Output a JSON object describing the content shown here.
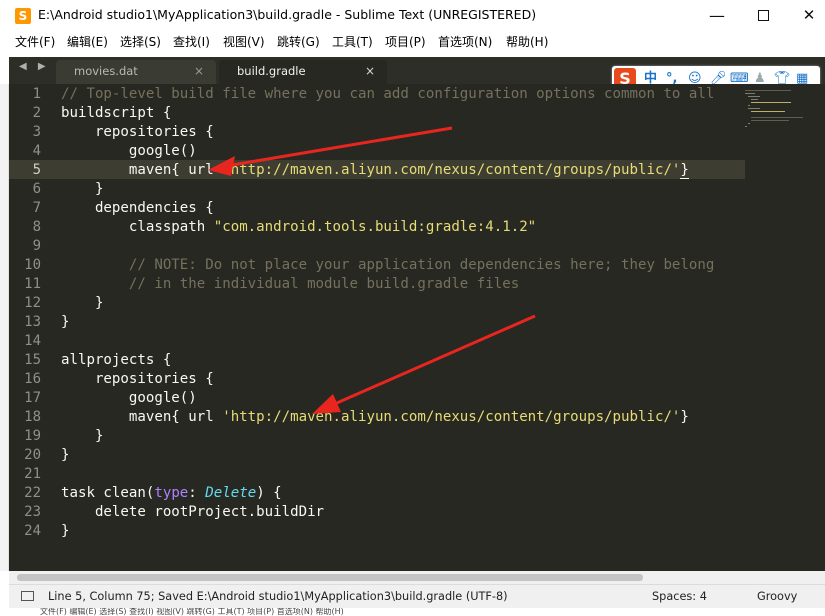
{
  "window": {
    "title": "E:\\Android studio1\\MyApplication3\\build.gradle - Sublime Text (UNREGISTERED)",
    "app_icon": "S",
    "buttons": {
      "minimize": "—",
      "close": "✕"
    }
  },
  "menubar": {
    "items": [
      {
        "label": "文件(F)"
      },
      {
        "label": "编辑(E)"
      },
      {
        "label": "选择(S)"
      },
      {
        "label": "查找(I)"
      },
      {
        "label": "视图(V)"
      },
      {
        "label": "跳转(G)"
      },
      {
        "label": "工具(T)"
      },
      {
        "label": "项目(P)"
      },
      {
        "label": "首选项(N)"
      },
      {
        "label": "帮助(H)"
      }
    ]
  },
  "tabs": {
    "nav_arrows": "◀ ▶",
    "items": [
      {
        "label": "movies.dat",
        "close": "×",
        "active": false
      },
      {
        "label": "build.gradle",
        "close": "×",
        "active": true
      }
    ]
  },
  "ime_toolbar": {
    "logo": "S",
    "lang": "中",
    "punct": "°,",
    "icons": [
      "emoji-icon",
      "mic-icon",
      "keyboard-icon",
      "user-icon",
      "shirt-icon",
      "grid-icon"
    ]
  },
  "editor": {
    "current_line": 5,
    "lines": [
      {
        "n": "1"
      },
      {
        "n": "2"
      },
      {
        "n": "3"
      },
      {
        "n": "4"
      },
      {
        "n": "5"
      },
      {
        "n": "6"
      },
      {
        "n": "7"
      },
      {
        "n": "8"
      },
      {
        "n": "9"
      },
      {
        "n": "10"
      },
      {
        "n": "11"
      },
      {
        "n": "12"
      },
      {
        "n": "13"
      },
      {
        "n": "14"
      },
      {
        "n": "15"
      },
      {
        "n": "16"
      },
      {
        "n": "17"
      },
      {
        "n": "18"
      },
      {
        "n": "19"
      },
      {
        "n": "20"
      },
      {
        "n": "21"
      },
      {
        "n": "22"
      },
      {
        "n": "23"
      },
      {
        "n": "24"
      }
    ],
    "code": {
      "l1": "// Top-level build file where you can add configuration options common to all",
      "l2": "buildscript {",
      "l3": "    repositories {",
      "l4": "        google()",
      "l5_a": "        maven{ url ",
      "l5_b": "'http://maven.aliyun.com/nexus/content/groups/public/'",
      "l5_c": "}",
      "l6": "    }",
      "l7": "    dependencies {",
      "l8_a": "        classpath ",
      "l8_b": "\"com.android.tools.build:gradle:4.1.2\"",
      "l10": "        // NOTE: Do not place your application dependencies here; they belong",
      "l11": "        // in the individual module build.gradle files",
      "l12": "    }",
      "l13": "}",
      "l15": "allprojects {",
      "l16": "    repositories {",
      "l17": "        google()",
      "l18_a": "        maven{ url ",
      "l18_b": "'http://maven.aliyun.com/nexus/content/groups/public/'",
      "l18_c": "}",
      "l19": "    }",
      "l20": "}",
      "l22_a": "task clean(",
      "l22_b": "type",
      "l22_c": ": ",
      "l22_d": "Delete",
      "l22_e": ") {",
      "l23": "    delete rootProject.buildDir",
      "l24": "}"
    }
  },
  "statusbar": {
    "position": "Line 5, Column 75; Saved E:\\Android studio1\\MyApplication3\\build.gradle (UTF-8)",
    "spaces": "Spaces: 4",
    "syntax": "Groovy"
  },
  "background_window": {
    "menu": "文件(F)   编辑(E)   选择(S)   查找(I)   视图(V)   跳转(G)   工具(T)   项目(P)   首选项(N)   帮助(H)"
  },
  "colors": {
    "editor_bg": "#272822",
    "comment": "#75715e",
    "string": "#e6db74",
    "keyword": "#ae81ff",
    "type": "#66d9ef",
    "annotation_arrow": "#e8261f"
  }
}
